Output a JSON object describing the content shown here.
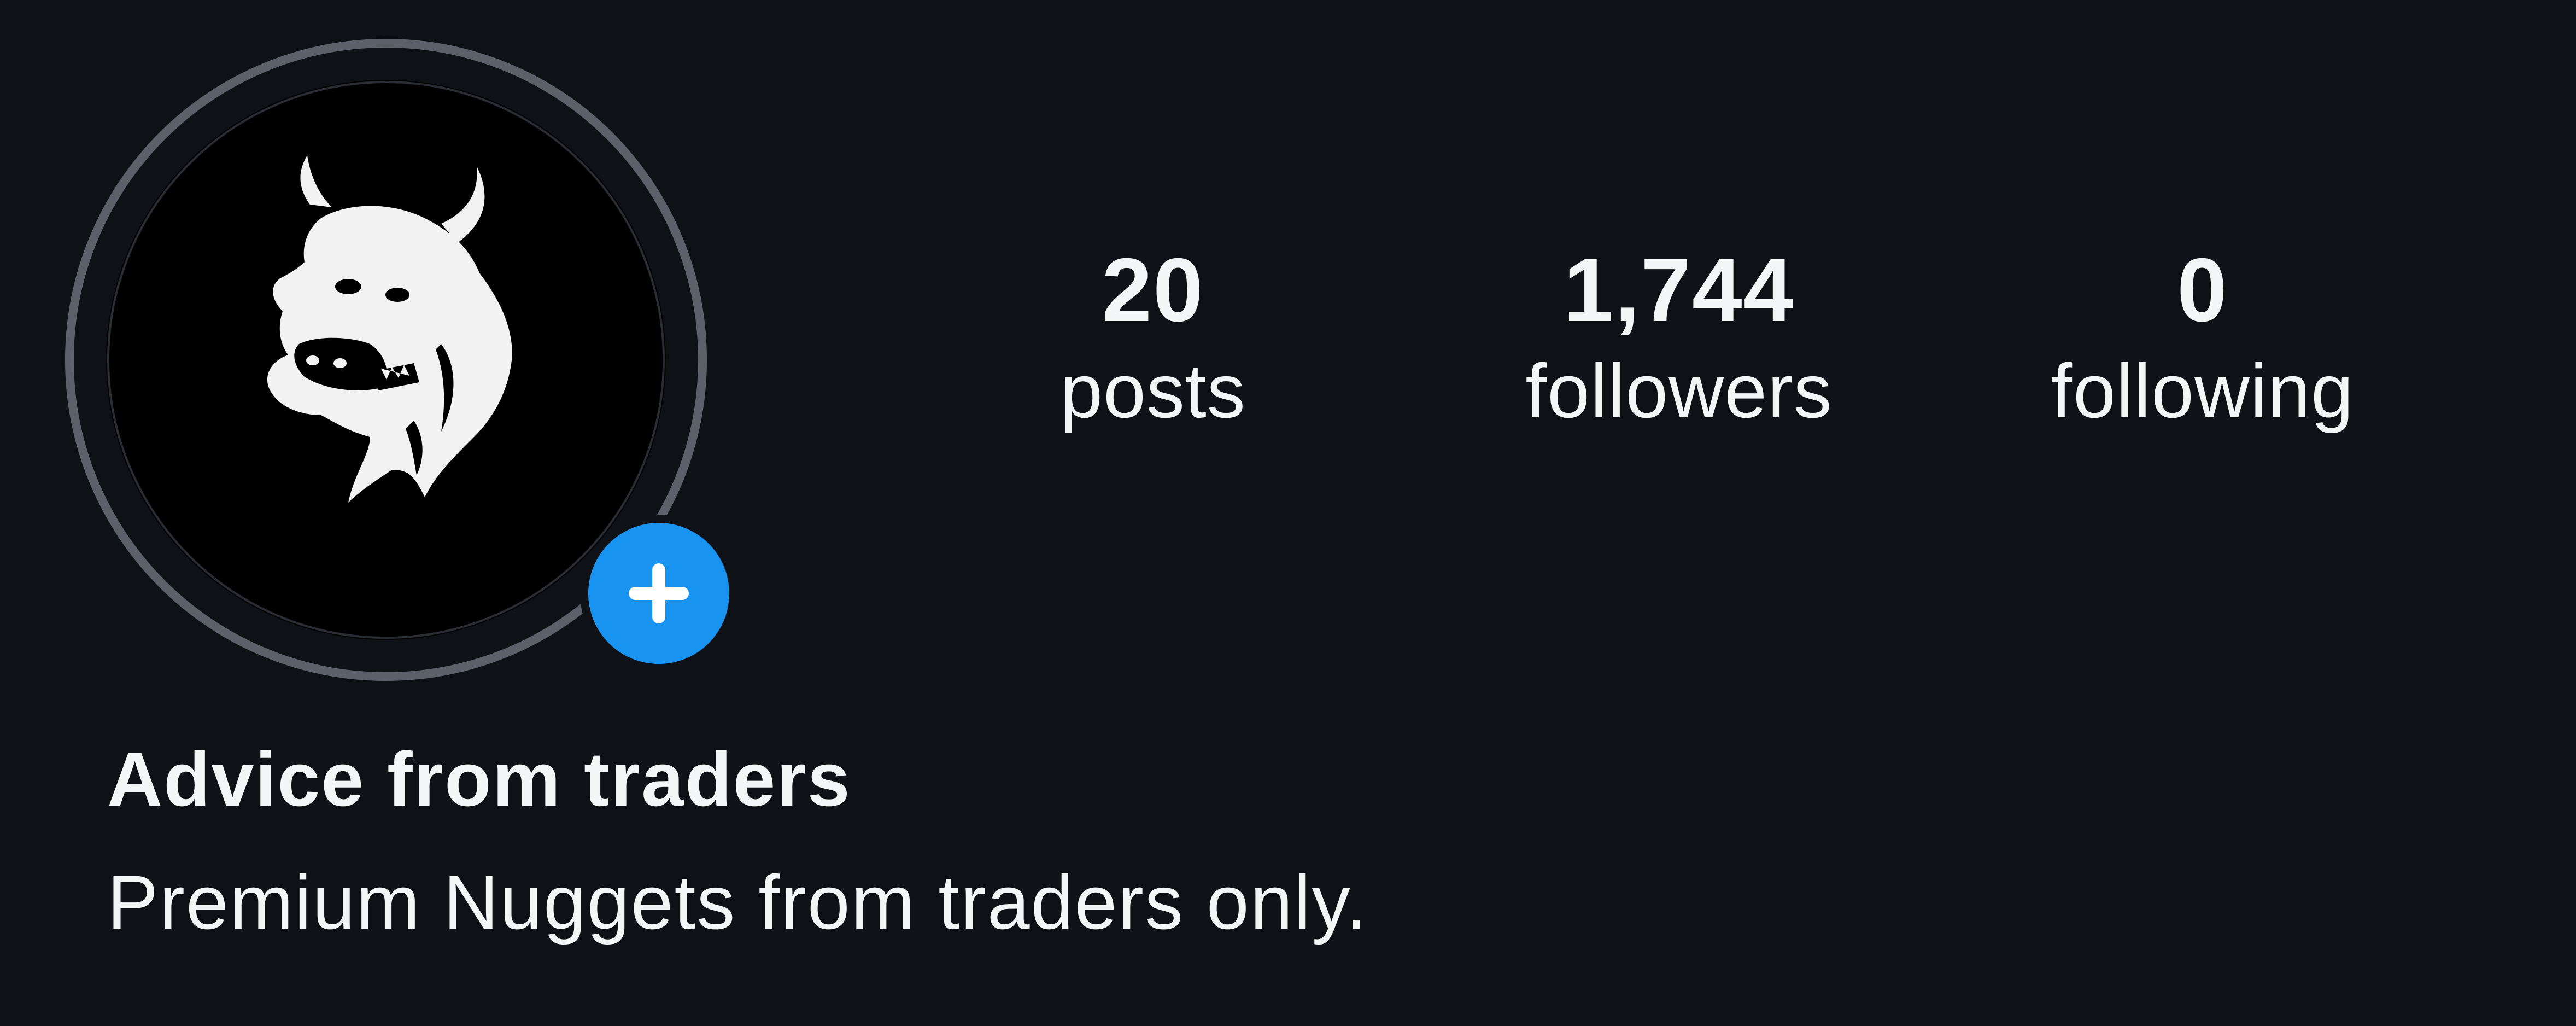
{
  "profile": {
    "display_name": "Advice from traders",
    "bio": "Premium Nuggets from traders only.",
    "avatar": {
      "icon": "bull-logo-icon",
      "background_color": "#000000",
      "story_ring_color": "#5a5e66"
    },
    "add_story": {
      "icon": "plus-icon",
      "color": "#1993f0"
    }
  },
  "stats": {
    "posts": {
      "count": "20",
      "label": "posts"
    },
    "followers": {
      "count": "1,744",
      "label": "followers"
    },
    "following": {
      "count": "0",
      "label": "following"
    }
  },
  "theme": {
    "background": "#0e1116",
    "text": "#f3f5f7"
  }
}
